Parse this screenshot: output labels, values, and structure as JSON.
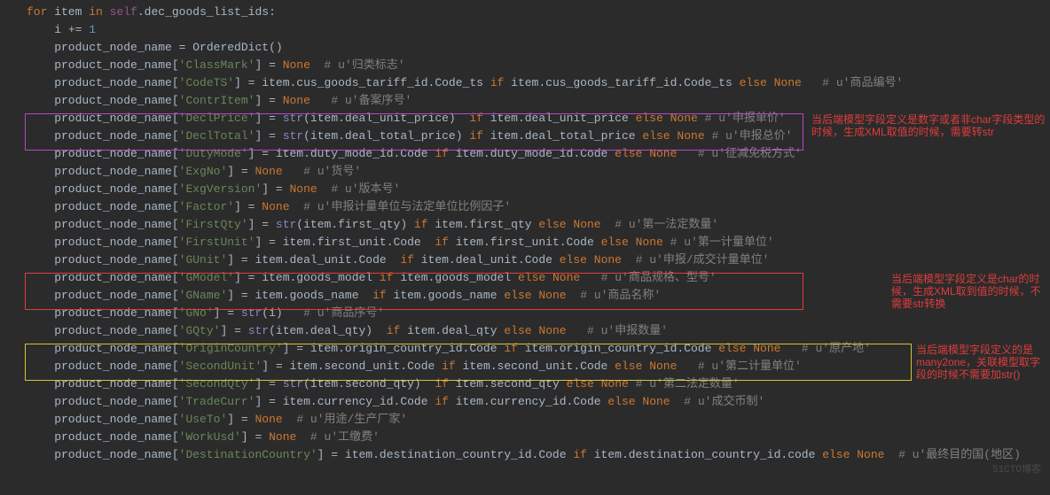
{
  "lines": [
    [
      [
        "kw",
        "for"
      ],
      [
        "ident",
        " item "
      ],
      [
        "kw",
        "in"
      ],
      [
        "ident",
        " "
      ],
      [
        "self",
        "self"
      ],
      [
        "ident",
        ".dec_goods_list_ids:"
      ]
    ],
    [
      [
        "ident",
        "    i "
      ],
      [
        "op",
        "+="
      ],
      [
        "ident",
        " "
      ],
      [
        "num",
        "1"
      ]
    ],
    [
      [
        "ident",
        "    product_node_name "
      ],
      [
        "op",
        "="
      ],
      [
        "ident",
        " OrderedDict()"
      ]
    ],
    [
      [
        "ident",
        "    product_node_name["
      ],
      [
        "str",
        "'ClassMark'"
      ],
      [
        "ident",
        "] "
      ],
      [
        "op",
        "="
      ],
      [
        "ident",
        " "
      ],
      [
        "none",
        "None"
      ],
      [
        "ident",
        "  "
      ],
      [
        "comment",
        "# u'归类标志'"
      ]
    ],
    [
      [
        "ident",
        "    product_node_name["
      ],
      [
        "str",
        "'CodeTS'"
      ],
      [
        "ident",
        "] "
      ],
      [
        "op",
        "="
      ],
      [
        "ident",
        " item.cus_goods_tariff_id.Code_ts "
      ],
      [
        "kw",
        "if"
      ],
      [
        "ident",
        " item.cus_goods_tariff_id.Code_ts "
      ],
      [
        "kw",
        "else"
      ],
      [
        "ident",
        " "
      ],
      [
        "none",
        "None"
      ],
      [
        "ident",
        "   "
      ],
      [
        "comment",
        "# u'商品编号'"
      ]
    ],
    [
      [
        "ident",
        "    product_node_name["
      ],
      [
        "str",
        "'ContrItem'"
      ],
      [
        "ident",
        "] "
      ],
      [
        "op",
        "="
      ],
      [
        "ident",
        " "
      ],
      [
        "none",
        "None"
      ],
      [
        "ident",
        "   "
      ],
      [
        "comment",
        "# u'备案序号'"
      ]
    ],
    [
      [
        "ident",
        "    product_node_name["
      ],
      [
        "str",
        "'DeclPrice'"
      ],
      [
        "ident",
        "] "
      ],
      [
        "op",
        "="
      ],
      [
        "ident",
        " "
      ],
      [
        "builtin",
        "str"
      ],
      [
        "ident",
        "(item.deal_unit_price)  "
      ],
      [
        "kw",
        "if"
      ],
      [
        "ident",
        " item.deal_unit_price "
      ],
      [
        "kw",
        "else"
      ],
      [
        "ident",
        " "
      ],
      [
        "none",
        "None"
      ],
      [
        "ident",
        " "
      ],
      [
        "comment",
        "# u'申报单价'"
      ]
    ],
    [
      [
        "ident",
        "    product_node_name["
      ],
      [
        "str",
        "'DeclTotal'"
      ],
      [
        "ident",
        "] "
      ],
      [
        "op",
        "="
      ],
      [
        "ident",
        " "
      ],
      [
        "builtin",
        "str"
      ],
      [
        "ident",
        "(item.deal_total_price) "
      ],
      [
        "kw",
        "if"
      ],
      [
        "ident",
        " item.deal_total_price "
      ],
      [
        "kw",
        "else"
      ],
      [
        "ident",
        " "
      ],
      [
        "none",
        "None"
      ],
      [
        "ident",
        " "
      ],
      [
        "comment",
        "# u'申报总价'"
      ]
    ],
    [
      [
        "ident",
        "    product_node_name["
      ],
      [
        "str",
        "'DutyMode'"
      ],
      [
        "ident",
        "] "
      ],
      [
        "op",
        "="
      ],
      [
        "ident",
        " item.duty_mode_id.Code "
      ],
      [
        "kw",
        "if"
      ],
      [
        "ident",
        " item.duty_mode_id.Code "
      ],
      [
        "kw",
        "else"
      ],
      [
        "ident",
        " "
      ],
      [
        "none",
        "None"
      ],
      [
        "ident",
        "   "
      ],
      [
        "comment",
        "# u'征减免税方式'"
      ]
    ],
    [
      [
        "ident",
        "    product_node_name["
      ],
      [
        "str",
        "'ExgNo'"
      ],
      [
        "ident",
        "] "
      ],
      [
        "op",
        "="
      ],
      [
        "ident",
        " "
      ],
      [
        "none",
        "None"
      ],
      [
        "ident",
        "   "
      ],
      [
        "comment",
        "# u'货号'"
      ]
    ],
    [
      [
        "ident",
        "    product_node_name["
      ],
      [
        "str",
        "'ExgVersion'"
      ],
      [
        "ident",
        "] "
      ],
      [
        "op",
        "="
      ],
      [
        "ident",
        " "
      ],
      [
        "none",
        "None"
      ],
      [
        "ident",
        "  "
      ],
      [
        "comment",
        "# u'版本号'"
      ]
    ],
    [
      [
        "ident",
        "    product_node_name["
      ],
      [
        "str",
        "'Factor'"
      ],
      [
        "ident",
        "] "
      ],
      [
        "op",
        "="
      ],
      [
        "ident",
        " "
      ],
      [
        "none",
        "None"
      ],
      [
        "ident",
        "  "
      ],
      [
        "comment",
        "# u'申报计量单位与法定单位比例因子'"
      ]
    ],
    [
      [
        "ident",
        "    product_node_name["
      ],
      [
        "str",
        "'FirstQty'"
      ],
      [
        "ident",
        "] "
      ],
      [
        "op",
        "="
      ],
      [
        "ident",
        " "
      ],
      [
        "builtin",
        "str"
      ],
      [
        "ident",
        "(item.first_qty) "
      ],
      [
        "kw",
        "if"
      ],
      [
        "ident",
        " item.first_qty "
      ],
      [
        "kw",
        "else"
      ],
      [
        "ident",
        " "
      ],
      [
        "none",
        "None"
      ],
      [
        "ident",
        "  "
      ],
      [
        "comment",
        "# u'第一法定数量'"
      ]
    ],
    [
      [
        "ident",
        "    product_node_name["
      ],
      [
        "str",
        "'FirstUnit'"
      ],
      [
        "ident",
        "] "
      ],
      [
        "op",
        "="
      ],
      [
        "ident",
        " item.first_unit.Code  "
      ],
      [
        "kw",
        "if"
      ],
      [
        "ident",
        " item.first_unit.Code "
      ],
      [
        "kw",
        "else"
      ],
      [
        "ident",
        " "
      ],
      [
        "none",
        "None"
      ],
      [
        "ident",
        " "
      ],
      [
        "comment",
        "# u'第一计量单位'"
      ]
    ],
    [
      [
        "ident",
        "    product_node_name["
      ],
      [
        "str",
        "'GUnit'"
      ],
      [
        "ident",
        "] "
      ],
      [
        "op",
        "="
      ],
      [
        "ident",
        " item.deal_unit.Code  "
      ],
      [
        "kw",
        "if"
      ],
      [
        "ident",
        " item.deal_unit.Code "
      ],
      [
        "kw",
        "else"
      ],
      [
        "ident",
        " "
      ],
      [
        "none",
        "None"
      ],
      [
        "ident",
        "  "
      ],
      [
        "comment",
        "# u'申报/成交计量单位'"
      ]
    ],
    [
      [
        "ident",
        "    product_node_name["
      ],
      [
        "str",
        "'GModel'"
      ],
      [
        "ident",
        "] "
      ],
      [
        "op",
        "="
      ],
      [
        "ident",
        " item.goods_model "
      ],
      [
        "kw",
        "if"
      ],
      [
        "ident",
        " item.goods_model "
      ],
      [
        "kw",
        "else"
      ],
      [
        "ident",
        " "
      ],
      [
        "none",
        "None"
      ],
      [
        "ident",
        "   "
      ],
      [
        "comment",
        "# u'商品规格、型号'"
      ]
    ],
    [
      [
        "ident",
        "    product_node_name["
      ],
      [
        "str",
        "'GName'"
      ],
      [
        "ident",
        "] "
      ],
      [
        "op",
        "="
      ],
      [
        "ident",
        " item.goods_name  "
      ],
      [
        "kw",
        "if"
      ],
      [
        "ident",
        " item.goods_name "
      ],
      [
        "kw",
        "else"
      ],
      [
        "ident",
        " "
      ],
      [
        "none",
        "None"
      ],
      [
        "ident",
        "  "
      ],
      [
        "comment",
        "# u'商品名称'"
      ]
    ],
    [
      [
        "ident",
        "    product_node_name["
      ],
      [
        "str",
        "'GNo'"
      ],
      [
        "ident",
        "] "
      ],
      [
        "op",
        "="
      ],
      [
        "ident",
        " "
      ],
      [
        "builtin",
        "str"
      ],
      [
        "ident",
        "(i)   "
      ],
      [
        "comment",
        "# u'商品序号'"
      ]
    ],
    [
      [
        "ident",
        "    product_node_name["
      ],
      [
        "str",
        "'GQty'"
      ],
      [
        "ident",
        "] "
      ],
      [
        "op",
        "="
      ],
      [
        "ident",
        " "
      ],
      [
        "builtin",
        "str"
      ],
      [
        "ident",
        "(item.deal_qty)  "
      ],
      [
        "kw",
        "if"
      ],
      [
        "ident",
        " item.deal_qty "
      ],
      [
        "kw",
        "else"
      ],
      [
        "ident",
        " "
      ],
      [
        "none",
        "None"
      ],
      [
        "ident",
        "   "
      ],
      [
        "comment",
        "# u'申报数量'"
      ]
    ],
    [
      [
        "ident",
        "    product_node_name["
      ],
      [
        "str",
        "'OriginCountry'"
      ],
      [
        "ident",
        "] "
      ],
      [
        "op",
        "="
      ],
      [
        "ident",
        " item.origin_country_id.Code "
      ],
      [
        "kw",
        "if"
      ],
      [
        "ident",
        " item.origin_country_id.Code "
      ],
      [
        "kw",
        "else"
      ],
      [
        "ident",
        " "
      ],
      [
        "none",
        "None"
      ],
      [
        "ident",
        "   "
      ],
      [
        "comment",
        "# u'原产地'"
      ]
    ],
    [
      [
        "ident",
        "    product_node_name["
      ],
      [
        "str",
        "'SecondUnit'"
      ],
      [
        "ident",
        "] "
      ],
      [
        "op",
        "="
      ],
      [
        "ident",
        " item.second_unit.Code "
      ],
      [
        "kw",
        "if"
      ],
      [
        "ident",
        " item.second_unit.Code "
      ],
      [
        "kw",
        "else"
      ],
      [
        "ident",
        " "
      ],
      [
        "none",
        "None"
      ],
      [
        "ident",
        "   "
      ],
      [
        "comment",
        "# u'第二计量单位'"
      ]
    ],
    [
      [
        "ident",
        "    product_node_name["
      ],
      [
        "str",
        "'SecondQty'"
      ],
      [
        "ident",
        "] "
      ],
      [
        "op",
        "="
      ],
      [
        "ident",
        " "
      ],
      [
        "builtin",
        "str"
      ],
      [
        "ident",
        "(item.second_qty)  "
      ],
      [
        "kw",
        "if"
      ],
      [
        "ident",
        " item.second_qty "
      ],
      [
        "kw",
        "else"
      ],
      [
        "ident",
        " "
      ],
      [
        "none",
        "None"
      ],
      [
        "ident",
        " "
      ],
      [
        "comment",
        "# u'第二法定数量'"
      ]
    ],
    [
      [
        "ident",
        "    product_node_name["
      ],
      [
        "str",
        "'TradeCurr'"
      ],
      [
        "ident",
        "] "
      ],
      [
        "op",
        "="
      ],
      [
        "ident",
        " item.currency_id.Code "
      ],
      [
        "kw",
        "if"
      ],
      [
        "ident",
        " item.currency_id.Code "
      ],
      [
        "kw",
        "else"
      ],
      [
        "ident",
        " "
      ],
      [
        "none",
        "None"
      ],
      [
        "ident",
        "  "
      ],
      [
        "comment",
        "# u'成交币制'"
      ]
    ],
    [
      [
        "ident",
        "    product_node_name["
      ],
      [
        "str",
        "'UseTo'"
      ],
      [
        "ident",
        "] "
      ],
      [
        "op",
        "="
      ],
      [
        "ident",
        " "
      ],
      [
        "none",
        "None"
      ],
      [
        "ident",
        "  "
      ],
      [
        "comment",
        "# u'用途/生产厂家'"
      ]
    ],
    [
      [
        "ident",
        "    product_node_name["
      ],
      [
        "str",
        "'WorkUsd'"
      ],
      [
        "ident",
        "] "
      ],
      [
        "op",
        "="
      ],
      [
        "ident",
        " "
      ],
      [
        "none",
        "None"
      ],
      [
        "ident",
        "  "
      ],
      [
        "comment",
        "# u'工缴费'"
      ]
    ],
    [
      [
        "ident",
        "    product_node_name["
      ],
      [
        "str",
        "'DestinationCountry'"
      ],
      [
        "ident",
        "] "
      ],
      [
        "op",
        "="
      ],
      [
        "ident",
        " item.destination_country_id.Code "
      ],
      [
        "kw",
        "if"
      ],
      [
        "ident",
        " item.destination_country_id.code "
      ],
      [
        "kw",
        "else"
      ],
      [
        "ident",
        " "
      ],
      [
        "none",
        "None"
      ],
      [
        "ident",
        "  "
      ],
      [
        "comment",
        "# u'最终目的国(地区)"
      ]
    ]
  ],
  "annotations": {
    "purple": "当后端模型字段定义是数字或者非char字段类型的时候，生成XML取值的时候，需要转str",
    "red": "当后端模型字段定义是char的时候，生成XML取到值的时候，不需要str转换",
    "yellow": "当后端模型字段定义的是many2one，关联模型取字段的时候不需要加str()"
  },
  "watermark": "51CTO博客"
}
